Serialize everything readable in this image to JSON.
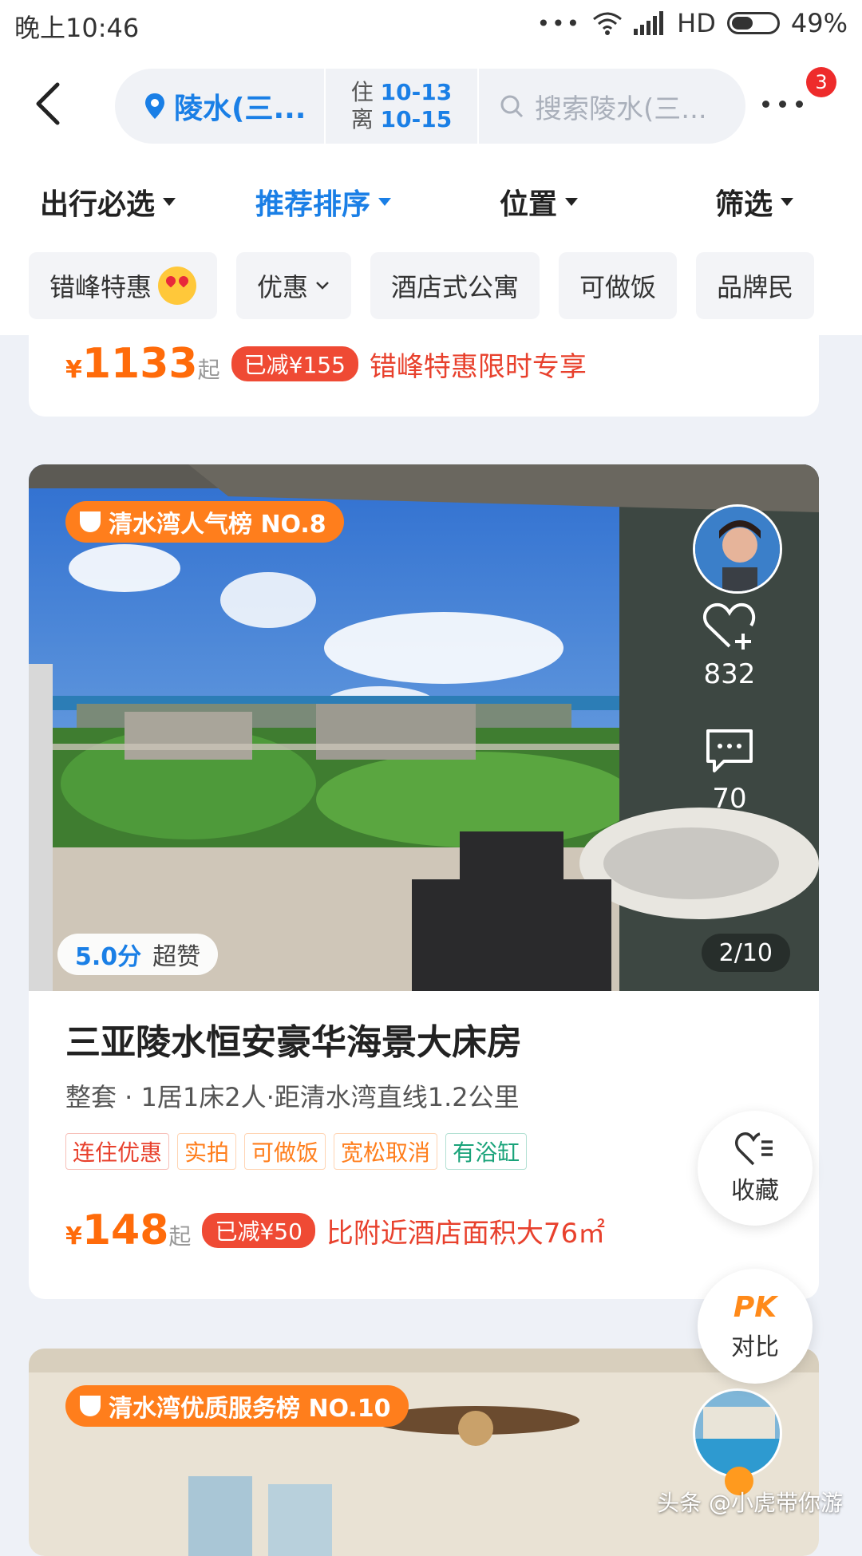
{
  "status_bar": {
    "time": "晚上10:46",
    "network": "HD",
    "battery": "49%",
    "battery_level": 0.49
  },
  "header": {
    "location": "陵水(三...",
    "checkin_label": "住",
    "checkin_date": "10-13",
    "checkout_label": "离",
    "checkout_date": "10-15",
    "search_placeholder": "搜索陵水(三...",
    "more_badge": "3"
  },
  "sort_tabs": [
    {
      "label": "出行必选"
    },
    {
      "label": "推荐排序"
    },
    {
      "label": "位置"
    },
    {
      "label": "筛选"
    }
  ],
  "chips": [
    "错峰特惠",
    "优惠",
    "酒店式公寓",
    "可做饭",
    "品牌民"
  ],
  "prev_card": {
    "currency": "¥",
    "price": "1133",
    "suffix": "起",
    "discount": "已减¥155",
    "promo": "错峰特惠限时专享"
  },
  "listing": {
    "rank_badge": "清水湾人气榜 NO.8",
    "likes": "832",
    "comments": "70",
    "score": "5.0分",
    "score_label": "超赞",
    "photo_index": "2/10",
    "title": "三亚陵水恒安豪华海景大床房",
    "subtitle": "整套 · 1居1床2人·距清水湾直线1.2公里",
    "tags": [
      {
        "text": "连住优惠",
        "color": "#e8412d"
      },
      {
        "text": "实拍",
        "color": "#ff7e1c"
      },
      {
        "text": "可做饭",
        "color": "#ff7e1c"
      },
      {
        "text": "宽松取消",
        "color": "#ff7e1c"
      },
      {
        "text": "有浴缸",
        "color": "#1aa37a"
      }
    ],
    "currency": "¥",
    "price": "148",
    "suffix": "起",
    "discount": "已减¥50",
    "promo": "比附近酒店面积大76㎡"
  },
  "float_buttons": {
    "favorite": "收藏",
    "pk_icon": "PK",
    "compare": "对比"
  },
  "next_card": {
    "rank_badge": "清水湾优质服务榜 NO.10"
  },
  "watermark": "头条 @小虎带你游",
  "colors": {
    "accent": "#1a7fe6",
    "price": "#ff6b0a",
    "promo": "#e8412d",
    "badge": "#ff7e1c"
  }
}
